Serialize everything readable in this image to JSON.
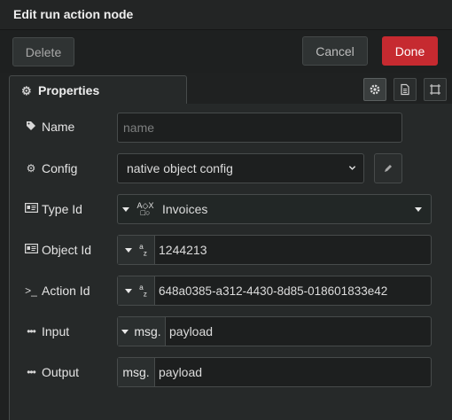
{
  "dialog": {
    "title": "Edit run action node"
  },
  "toolbar": {
    "delete_label": "Delete",
    "cancel_label": "Cancel",
    "done_label": "Done"
  },
  "colors": {
    "done_bg": "#c62a30",
    "panel_bg": "#262929",
    "field_bg": "#1d1f1f",
    "border": "#474b4b"
  },
  "tabs": {
    "properties_label": "Properties",
    "icons": [
      "gear-icon",
      "document-icon",
      "frame-icon"
    ]
  },
  "form": {
    "name": {
      "label": "Name",
      "placeholder": "name",
      "value": ""
    },
    "config": {
      "label": "Config",
      "value": "native object config"
    },
    "type_id": {
      "label": "Type Id",
      "type_glyph": "A◇X\n□○",
      "value": "Invoices"
    },
    "object_id": {
      "label": "Object Id",
      "type_glyph": "az",
      "value": "1244213"
    },
    "action_id": {
      "label": "Action Id",
      "type_glyph": "az",
      "value": "648a0385-a312-4430-8d85-018601833e42"
    },
    "input": {
      "label": "Input",
      "prefix": "msg.",
      "value": "payload"
    },
    "output": {
      "label": "Output",
      "prefix": "msg.",
      "value": "payload"
    }
  }
}
